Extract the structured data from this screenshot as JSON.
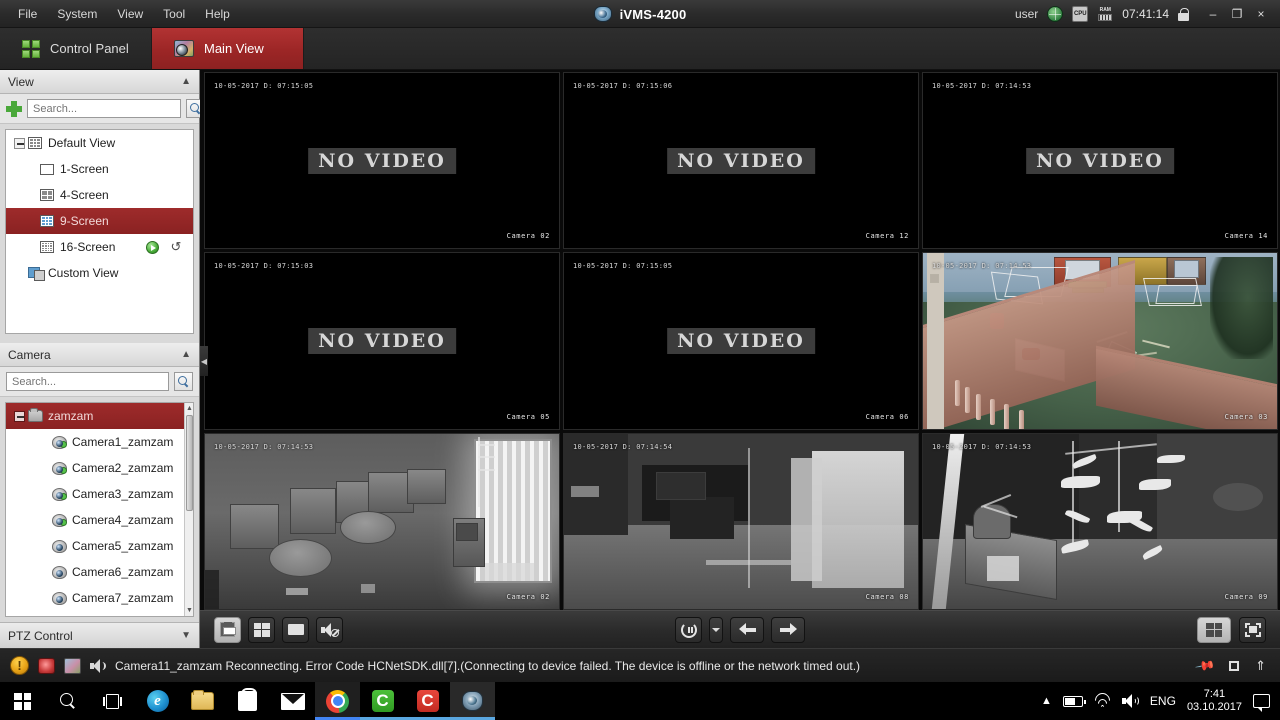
{
  "window": {
    "title": "iVMS-4200",
    "app_logo_icon": "camera-dome-icon",
    "menus": [
      "File",
      "System",
      "View",
      "Tool",
      "Help"
    ],
    "user": "user",
    "globe_icon": "globe-icon",
    "cpu_icon": "cpu-icon",
    "cpu_label": "CPU",
    "ram_icon": "ram-icon",
    "ram_label": "RAM",
    "time": "07:41:14",
    "lock_icon": "lock-icon",
    "minimize": "–",
    "restore": "❐",
    "close": "×"
  },
  "tabs": [
    {
      "label": "Control Panel",
      "icon": "control-panel-icon",
      "active": false
    },
    {
      "label": "Main View",
      "icon": "main-view-icon",
      "active": true
    }
  ],
  "sidebar": {
    "view_panel": {
      "title": "View",
      "collapse_icon": "chevron-up-icon",
      "add_icon": "plus-icon",
      "search_placeholder": "Search...",
      "search_value": "",
      "search_icon": "search-icon",
      "tree": [
        {
          "label": "Default View",
          "icon": "grid-view-icon",
          "level": 0,
          "expander": "minus",
          "selected": false
        },
        {
          "label": "1-Screen",
          "icon": "screen-1-icon",
          "level": 1,
          "selected": false
        },
        {
          "label": "4-Screen",
          "icon": "screen-4-icon",
          "level": 1,
          "selected": false
        },
        {
          "label": "9-Screen",
          "icon": "screen-9-icon",
          "level": 1,
          "selected": true
        },
        {
          "label": "16-Screen",
          "icon": "screen-16-icon",
          "level": 1,
          "selected": false,
          "start_icon": "play-green-icon",
          "refresh_icon": "refresh-icon"
        },
        {
          "label": "Custom View",
          "icon": "custom-view-icon",
          "level": 0,
          "selected": false
        }
      ]
    },
    "camera_panel": {
      "title": "Camera",
      "collapse_icon": "chevron-up-icon",
      "search_placeholder": "Search...",
      "search_value": "",
      "search_icon": "search-icon",
      "group": {
        "label": "zamzam",
        "icon": "folder-icon",
        "expander": "minus",
        "selected": true
      },
      "cameras": [
        {
          "label": "Camera1_zamzam",
          "icon": "camera-icon",
          "online": true
        },
        {
          "label": "Camera2_zamzam",
          "icon": "camera-icon",
          "online": true
        },
        {
          "label": "Camera3_zamzam",
          "icon": "camera-icon",
          "online": true
        },
        {
          "label": "Camera4_zamzam",
          "icon": "camera-icon",
          "online": true
        },
        {
          "label": "Camera5_zamzam",
          "icon": "camera-icon",
          "online": false
        },
        {
          "label": "Camera6_zamzam",
          "icon": "camera-icon",
          "online": false
        },
        {
          "label": "Camera7_zamzam",
          "icon": "camera-icon",
          "online": false
        }
      ]
    },
    "ptz_panel": {
      "title": "PTZ Control",
      "expand_icon": "chevron-down-icon"
    },
    "collapse_tab_icon": "collapse-left-icon"
  },
  "video_grid": {
    "layout": "9-screen",
    "no_video_text": "NO VIDEO",
    "cells": [
      {
        "timestamp": "10-05-2017 D: 07:15:05",
        "camera_label": "Camera 02",
        "state": "no-video"
      },
      {
        "timestamp": "10-05-2017 D: 07:15:06",
        "camera_label": "Camera 12",
        "state": "no-video"
      },
      {
        "timestamp": "10-05-2017 D: 07:14:53",
        "camera_label": "Camera 14",
        "state": "no-video"
      },
      {
        "timestamp": "10-05-2017 D: 07:15:03",
        "camera_label": "Camera 05",
        "state": "no-video"
      },
      {
        "timestamp": "10-05-2017 D: 07:15:05",
        "camera_label": "Camera 06",
        "state": "no-video"
      },
      {
        "timestamp": "10-05-2017 D: 07:14:53",
        "camera_label": "Camera 03",
        "state": "playground"
      },
      {
        "timestamp": "10-05-2017 D: 07:14:53",
        "camera_label": "Camera 02",
        "state": "ir-classroom"
      },
      {
        "timestamp": "10-05-2017 D: 07:14:54",
        "camera_label": "Camera 08",
        "state": "ir-dark-room"
      },
      {
        "timestamp": "10-05-2017 D: 07:14:53",
        "camera_label": "Camera 09",
        "state": "ir-mobiles"
      }
    ]
  },
  "toolbar": {
    "left": [
      {
        "name": "save-view-button",
        "icon": "save-layout-icon",
        "active": true
      },
      {
        "name": "multi-layout-button",
        "icon": "multi-window-icon",
        "active": false
      },
      {
        "name": "single-screen-button",
        "icon": "single-screen-icon",
        "active": false
      },
      {
        "name": "mute-button",
        "icon": "speaker-mute-icon",
        "active": false
      }
    ],
    "center": [
      {
        "name": "auto-switch-button",
        "icon": "auto-switch-pause-icon"
      },
      {
        "name": "auto-switch-dropdown",
        "icon": "caret-down-icon"
      },
      {
        "name": "previous-button",
        "icon": "arrow-left-icon"
      },
      {
        "name": "next-button",
        "icon": "arrow-right-icon"
      }
    ],
    "right": [
      {
        "name": "layout-selector-button",
        "icon": "window-division-icon",
        "active": true
      },
      {
        "name": "fullscreen-button",
        "icon": "fullscreen-icon",
        "active": false
      }
    ]
  },
  "statusbar": {
    "warning_icon": "warning-icon",
    "alarm_icon": "alarm-icon",
    "picture_icon": "picture-icon",
    "audio_icon": "audio-icon",
    "message": "Camera11_zamzam Reconnecting. Error Code HCNetSDK.dll[7].(Connecting to device failed. The device is offline or the network timed out.)",
    "pin_icon": "pin-icon",
    "maximize_icon": "maximize-icon",
    "expand_icon": "chevron-up-double-icon"
  },
  "taskbar": {
    "items": [
      {
        "name": "start-button",
        "icon": "windows-logo-icon"
      },
      {
        "name": "search-button",
        "icon": "search-icon"
      },
      {
        "name": "task-view-button",
        "icon": "task-view-icon"
      },
      {
        "name": "edge-button",
        "icon": "edge-icon",
        "glyph": "e"
      },
      {
        "name": "file-explorer-button",
        "icon": "folder-icon"
      },
      {
        "name": "store-button",
        "icon": "store-icon"
      },
      {
        "name": "mail-button",
        "icon": "mail-icon"
      },
      {
        "name": "chrome-button",
        "icon": "chrome-icon",
        "active": true,
        "accent": "#4285f4"
      },
      {
        "name": "app-green-button",
        "icon": "app-green-icon",
        "glyph": "C",
        "active": true,
        "accent": "#5aa7e0"
      },
      {
        "name": "app-red-button",
        "icon": "app-red-icon",
        "glyph": "C",
        "active": true,
        "accent": "#5aa7e0"
      },
      {
        "name": "ivms-button",
        "icon": "ivms-icon",
        "active": true,
        "accent": "#5aa7e0"
      }
    ],
    "tray": {
      "chevron_icon": "chevron-up-icon",
      "battery_icon": "battery-icon",
      "wifi_icon": "wifi-icon",
      "volume_icon": "volume-icon",
      "language": "ENG",
      "time": "7:41",
      "date": "03.10.2017",
      "notifications_icon": "notification-icon"
    }
  },
  "colors": {
    "accent_red": "#9c2626",
    "panel_bg": "#d9d9d9",
    "chrome_dark": "#2a2a2a"
  }
}
